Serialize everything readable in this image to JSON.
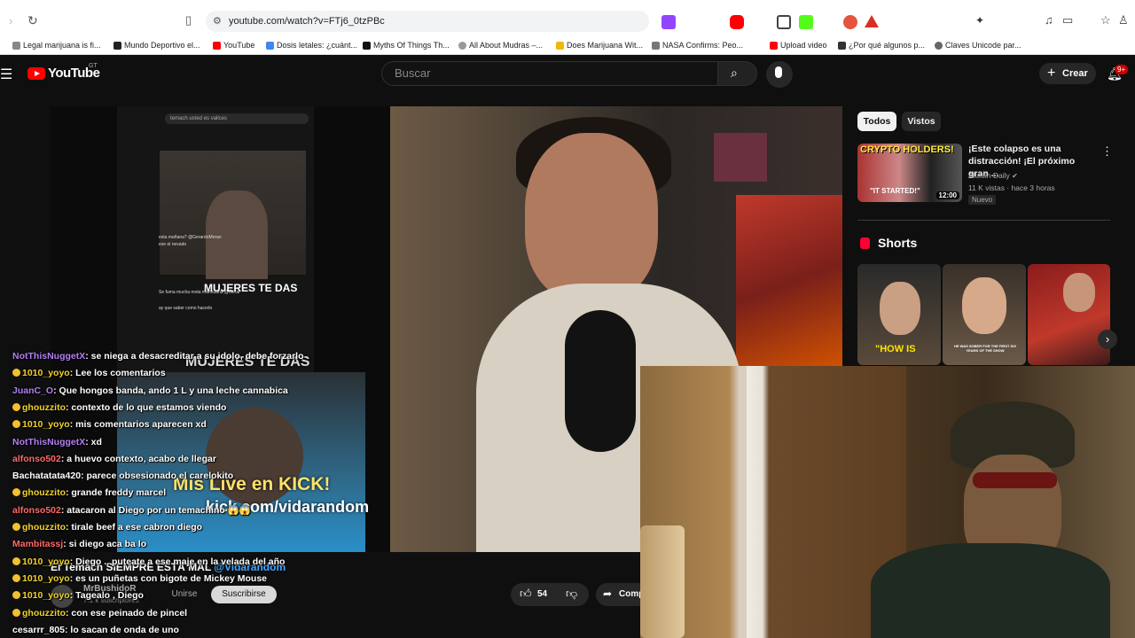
{
  "browser": {
    "url": "youtube.com/watch?v=FTj6_0tzPBc",
    "bookmarks": [
      {
        "label": "Legal marijuana is fi..."
      },
      {
        "label": "Mundo Deportivo el..."
      },
      {
        "label": "YouTube"
      },
      {
        "label": "Dosis letales: ¿cuánt..."
      },
      {
        "label": "Myths Of Things Th..."
      },
      {
        "label": "All About Mudras –..."
      },
      {
        "label": "Does Marijuana Wit..."
      },
      {
        "label": "NASA Confirms: Peo..."
      },
      {
        "label": "Upload video"
      },
      {
        "label": "¿Por qué algunos p..."
      },
      {
        "label": "Claves Unicode par..."
      }
    ],
    "colors": {
      "accent": "#1a73e8"
    }
  },
  "header": {
    "logo_text": "YouTube",
    "country_code": "GT",
    "search_placeholder": "Buscar",
    "create_label": "Crear",
    "notifications_badge": "9+"
  },
  "video": {
    "phone_search_text": "temach usted es vallces",
    "phone_caption": "MUJERES TE DAS",
    "phone_small_lines": [
      "esta mañana? @GerardoMoran",
      "ese el nevado",
      "Se fuma mucha mota marihuana @Gerar",
      "ay que saber como hacerlo"
    ],
    "overlay_caption": "MUJERES TE DAS",
    "promo_line": "Mis Live en KICK!",
    "promo_url": "kick.com/vidarandom",
    "bottom_caption": "El Temach SIEMPRE ESTÁ MAL",
    "bottom_handle": "@Vidarandom"
  },
  "chat": [
    {
      "user": "NotThisNuggetX",
      "color": "#b27ff5",
      "message": ": se niega a desacreditar a su idolo, debe forzarlo",
      "badges": false
    },
    {
      "user": "1010_yoyo",
      "color": "#f2d32b",
      "message": ": Lee los comentarios",
      "badges": true
    },
    {
      "user": "JuanC_O",
      "color": "#b27ff5",
      "message": ": Que hongos banda, ando 1 L y una leche cannabica",
      "badges": false
    },
    {
      "user": "ghouzzito",
      "color": "#f2d32b",
      "message": ": contexto de lo que estamos viendo",
      "badges": true
    },
    {
      "user": "1010_yoyo",
      "color": "#f2d32b",
      "message": ": mis comentarios aparecen xd",
      "badges": true
    },
    {
      "user": "NotThisNuggetX",
      "color": "#b27ff5",
      "message": ": xd",
      "badges": false
    },
    {
      "user": "alfonso502",
      "color": "#ff6a6a",
      "message": ": a huevo contexto, acabo de llegar",
      "badges": false
    },
    {
      "user": "Bachatatata420",
      "color": "#ffffff",
      "message": ": parece obsesionado el carelokito",
      "badges": false
    },
    {
      "user": "ghouzzito",
      "color": "#f2d32b",
      "message": ": grande freddy marcel",
      "badges": true
    },
    {
      "user": "alfonso502",
      "color": "#ff6a6a",
      "message": ": atacaron al Diego por un temachino 😱😱",
      "badges": false
    },
    {
      "user": "ghouzzito",
      "color": "#f2d32b",
      "message": ": tirale beef a ese cabron diego",
      "badges": true
    },
    {
      "user": "Mambitassj",
      "color": "#ff6a6a",
      "message": ": si diego aca ba lo",
      "badges": false
    },
    {
      "user": "1010_yoyo",
      "color": "#f2d32b",
      "message": ": Diego .. puteate a ese maje en la velada del año",
      "badges": true
    },
    {
      "user": "1010_yoyo",
      "color": "#f2d32b",
      "message": ": es un puñetas con bigote de Mickey Mouse",
      "badges": true
    },
    {
      "user": "1010_yoyo",
      "color": "#f2d32b",
      "message": ": Tagealo , Diego",
      "badges": true
    },
    {
      "user": "ghouzzito",
      "color": "#f2d32b",
      "message": ": con ese peinado de pincel",
      "badges": true
    },
    {
      "user": "cesarrr_805",
      "color": "#ffffff",
      "message": ": lo sacan de onda de uno",
      "badges": false
    }
  ],
  "channel": {
    "name": "MrBushidoR",
    "subscribers": "7.1 k suscriptores",
    "join_label": "Unirse",
    "subscribe_label": "Suscribirse"
  },
  "actions": {
    "like_count": "54",
    "share_label": "Comp"
  },
  "sidebar": {
    "chips": [
      {
        "label": "Todos",
        "active": true
      },
      {
        "label": "Vistos",
        "active": false
      }
    ],
    "recommended": {
      "thumb_text": "CRYPTO HOLDERS!",
      "thumb_sub": "\"IT STARTED!\"",
      "duration": "12:00",
      "title": "¡Este colapso es una distracción! ¡El próximo gran ...",
      "channel": "Altcoin Daily",
      "meta": "11 K vistas · hace 3 horas",
      "badge": "Nuevo"
    },
    "shorts_label": "Shorts",
    "shorts": [
      {
        "caption": "\"HOW IS"
      },
      {
        "caption": "HE WAS SOBER FOR THE FIRST SIX YEARS OF THE SHOW"
      },
      {
        "caption": ""
      }
    ]
  }
}
